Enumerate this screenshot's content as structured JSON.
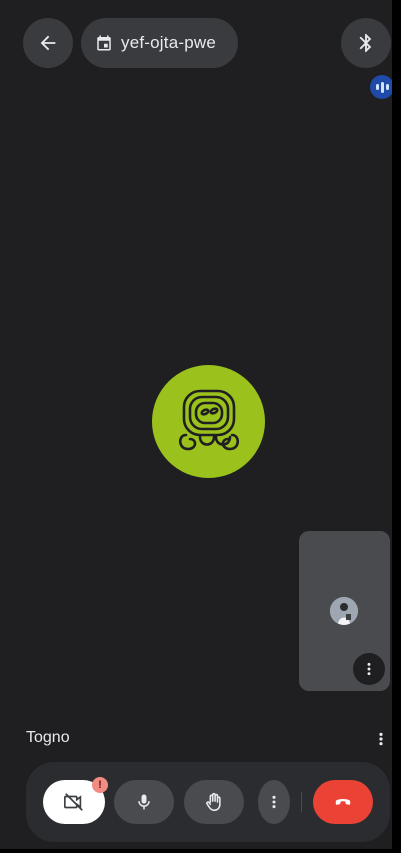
{
  "meeting": {
    "code": "yef-ojta-pwe"
  },
  "participant": {
    "name": "Togno"
  },
  "badges": {
    "camera_alert": "!"
  },
  "icons": {
    "back": "arrow-left-icon",
    "calendar": "calendar-icon",
    "bluetooth": "bluetooth-icon",
    "speaking": "audio-level-icon",
    "camera_off": "camera-off-icon",
    "mic": "microphone-icon",
    "raise_hand": "hand-icon",
    "more": "more-vert-icon",
    "end_call": "end-call-icon"
  },
  "colors": {
    "background": "#1f1f21",
    "avatar": "#9bc21c",
    "end_call": "#ea4335",
    "speaking": "#1f4aa8"
  }
}
